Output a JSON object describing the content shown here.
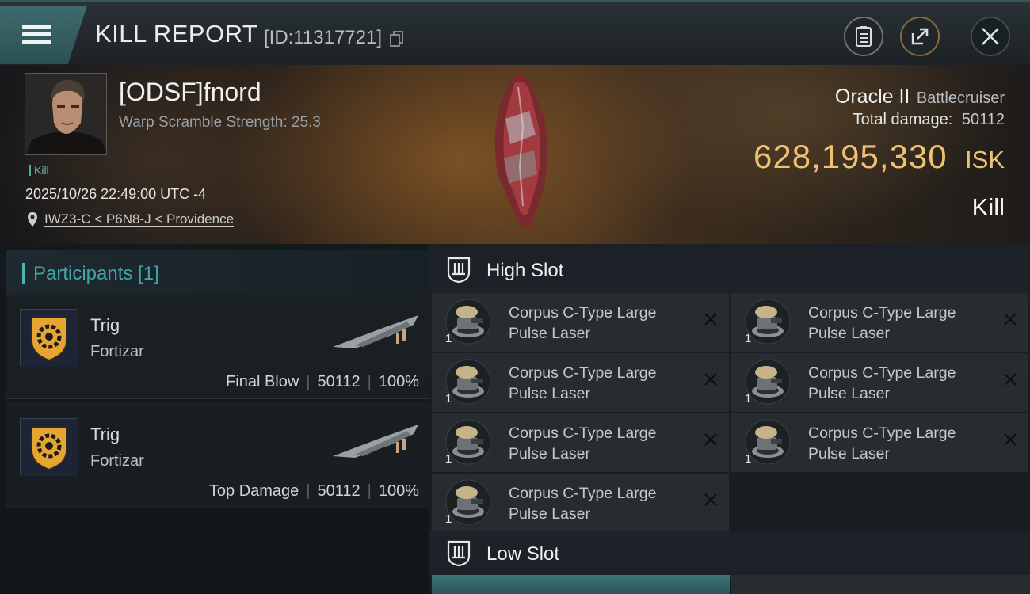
{
  "window": {
    "title": "KILL REPORT",
    "report_id": "[ID:11317721]"
  },
  "victim": {
    "name": "[ODSF]fnord",
    "warp_scramble": "Warp Scramble Strength: 25.3",
    "badge": "Kill",
    "timestamp": "2025/10/26 22:49:00 UTC -4",
    "location": "IWZ3-C < P6N8-J < Providence",
    "ship_name": "Oracle II",
    "ship_class": "Battlecruiser",
    "total_damage_label": "Total damage:",
    "total_damage": "50112",
    "isk_value": "628,195,330",
    "isk_unit": "ISK",
    "result": "Kill"
  },
  "participants": {
    "header": "Participants [1]",
    "cards": [
      {
        "name": "Trig",
        "ship": "Fortizar",
        "role": "Final Blow",
        "damage": "50112",
        "percent": "100%"
      },
      {
        "name": "Trig",
        "ship": "Fortizar",
        "role": "Top Damage",
        "damage": "50112",
        "percent": "100%"
      }
    ]
  },
  "slots": {
    "high": {
      "label": "High Slot",
      "modules": [
        {
          "line1": "Corpus C-Type Large",
          "line2": "Pulse Laser",
          "qty": "1"
        },
        {
          "line1": "Corpus C-Type Large",
          "line2": "Pulse Laser",
          "qty": "1"
        },
        {
          "line1": "Corpus C-Type Large",
          "line2": "Pulse Laser",
          "qty": "1"
        },
        {
          "line1": "Corpus C-Type Large",
          "line2": "Pulse Laser",
          "qty": "1"
        },
        {
          "line1": "Corpus C-Type Large",
          "line2": "Pulse Laser",
          "qty": "1"
        },
        {
          "line1": "Corpus C-Type Large",
          "line2": "Pulse Laser",
          "qty": "1"
        },
        {
          "line1": "Corpus C-Type Large",
          "line2": "Pulse Laser",
          "qty": "1"
        }
      ]
    },
    "low": {
      "label": "Low Slot"
    }
  },
  "colors": {
    "accent": "#3fa5a5",
    "isk": "#f0c172"
  }
}
